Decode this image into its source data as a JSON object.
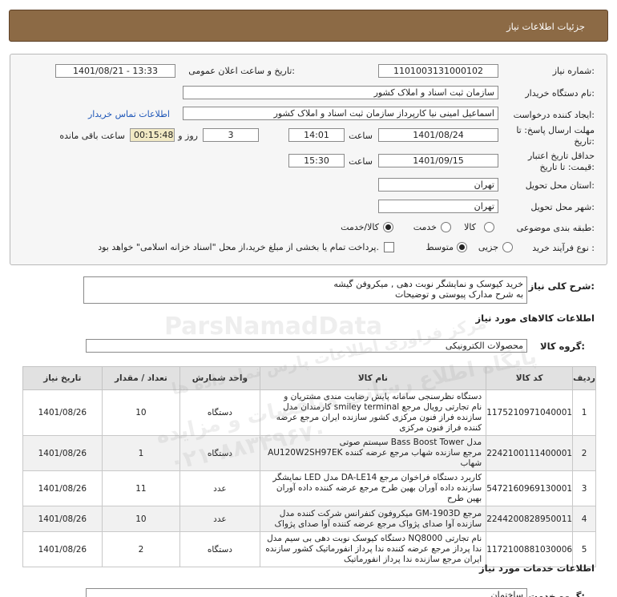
{
  "header": {
    "title": "جزئیات اطلاعات نیاز"
  },
  "form": {
    "need_number_label": "شماره نیاز:",
    "need_number": "1101003131000102",
    "announce_label": "تاریخ و ساعت اعلان عمومی:",
    "announce_value": "1401/08/21 - 13:33",
    "buyer_label": "نام دستگاه خریدار:",
    "buyer_value": "سازمان ثبت اسناد و املاک کشور",
    "creator_label": "ایجاد کننده درخواست:",
    "creator_value": "اسماعیل امینی نیا کارپرداز سازمان ثبت اسناد و املاک کشور",
    "contact_link": "اطلاعات تماس خریدار",
    "deadline_label_1": "مهلت ارسال پاسخ: تا",
    "deadline_label_2": "تاریخ:",
    "deadline_date": "1401/08/24",
    "time_label": "ساعت",
    "deadline_time": "14:01",
    "days_value": "3",
    "days_label": "روز و",
    "remaining_time": "00:15:48",
    "remaining_label": "ساعت باقی مانده",
    "validity_label_1": "حداقل تاریخ اعتبار",
    "validity_label_2": "قیمت: تا تاریخ:",
    "validity_date": "1401/09/15",
    "validity_time_label": "ساعت",
    "validity_time": "15:30",
    "province_label": "استان محل تحویل:",
    "province_value": "تهران",
    "city_label": "شهر محل تحویل:",
    "city_value": "تهران",
    "category_label": "طبقه بندی موضوعی:",
    "category_options": [
      "کالا",
      "خدمت",
      "کالا/خدمت"
    ],
    "category_selected": "کالا/خدمت",
    "process_label": "نوع فرآیند خرید :",
    "process_options": [
      "جزیی",
      "متوسط"
    ],
    "process_selected": "متوسط",
    "payment_note": "پرداخت تمام یا بخشی از مبلغ خرید،از محل \"اسناد خزانه اسلامی\" خواهد بود."
  },
  "description": {
    "label": "شرح کلی نیاز:",
    "line1": "خرید کیوسک و نمایشگر نوبت دهی , میکروفن گیشه",
    "line2": "به شرح مدارک پیوستی و توضیحات"
  },
  "goods": {
    "section_title": "اطلاعات کالاهای مورد نیاز",
    "group_label": "گروه کالا:",
    "group_value": "محصولات الکترونیکی",
    "columns": [
      "ردیف",
      "کد کالا",
      "نام کالا",
      "واحد شمارش",
      "تعداد / مقدار",
      "تاریخ نیاز"
    ],
    "rows": [
      {
        "row": "1",
        "code": "1175210971040001",
        "name": "دستگاه نظرسنجی سامانه پایش رضایت مندی مشتریان و کارمندان مدل smiley terminal نام تجارتی رویال مرجع سازنده فراز فنون مرکزی کشور سازنده ایران مرجع عرضه کننده فراز فنون مرکزی",
        "unit": "دستگاه",
        "qty": "10",
        "date": "1401/08/26"
      },
      {
        "row": "2",
        "code": "2242100111400001",
        "name": "سیستم صوتی Bass Boost Tower مدل AU120W2SH97EK مرجع سازنده شهاب مرجع عرضه کننده شهاب",
        "unit": "دستگاه",
        "qty": "1",
        "date": "1401/08/26"
      },
      {
        "row": "3",
        "code": "5472160969130001",
        "name": "نمایشگر LED مدل DA-LE14 کاربرد دستگاه فراخوان مرجع سازنده داده آوران بهین طرح مرجع عرضه کننده داده آوران بهین طرح",
        "unit": "عدد",
        "qty": "11",
        "date": "1401/08/26"
      },
      {
        "row": "4",
        "code": "2244200828950011",
        "name": "میکروفون کنفرانس شرکت کننده مدل GM-1903D مرجع سازنده آوا صدای پژواک مرجع عرضه کننده آوا صدای پژواک",
        "unit": "عدد",
        "qty": "10",
        "date": "1401/08/26"
      },
      {
        "row": "5",
        "code": "1172100881030006",
        "name": "دستگاه کیوسک نوبت دهی بی سیم مدل NQ8000 نام تجارتی ندا پرداز مرجع عرضه کننده ندا پرداز انفورماتیک کشور سازنده ایران مرجع سازنده ندا پرداز انفورماتیک",
        "unit": "دستگاه",
        "qty": "2",
        "date": "1401/08/26"
      }
    ]
  },
  "services": {
    "section_title": "اطلاعات خدمات مورد نیاز",
    "group_label": "گروه خدمت:",
    "group_value": "ساختمان"
  },
  "watermark": {
    "brand": "ParsNamadData",
    "tagline": "پایگاه اطلاع رسانی مناقصات و مزایده",
    "phone": "۰۲۱-۸۸۳۴۹۶۷۰",
    "tagline2": "مرکز فراوری اطلاعات پارس نماد داده ها"
  }
}
